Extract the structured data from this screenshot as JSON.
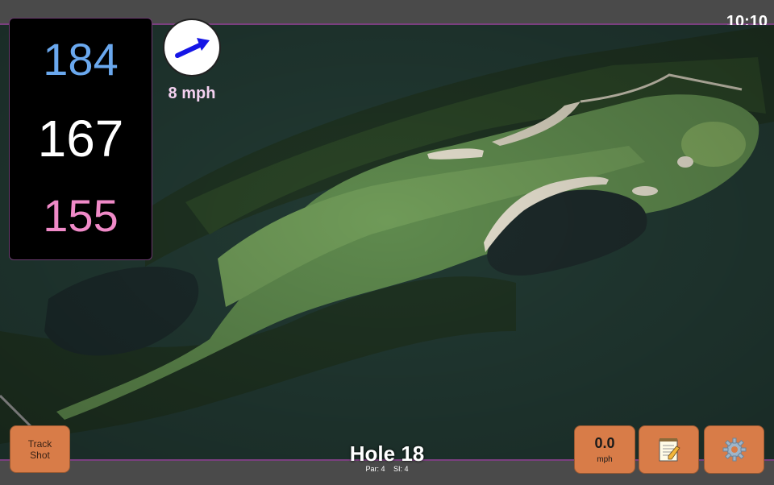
{
  "status": {
    "time": "10:10"
  },
  "distances": {
    "back": "184",
    "middle": "167",
    "front": "155"
  },
  "wind": {
    "speed": "8 mph",
    "direction_icon": "wind-arrow-icon"
  },
  "hole": {
    "title": "Hole 18",
    "par": "Par: 4",
    "si": "SI: 4"
  },
  "buttons": {
    "track_shot": "Track\nShot",
    "speed_value": "0.0",
    "speed_unit": "mph",
    "notes_icon": "notepad-icon",
    "settings_icon": "gear-icon"
  },
  "colors": {
    "back": "#6aa8ee",
    "middle": "#ffffff",
    "front": "#f08ac8",
    "button": "#d87c48",
    "accent": "#7a3f7f"
  }
}
